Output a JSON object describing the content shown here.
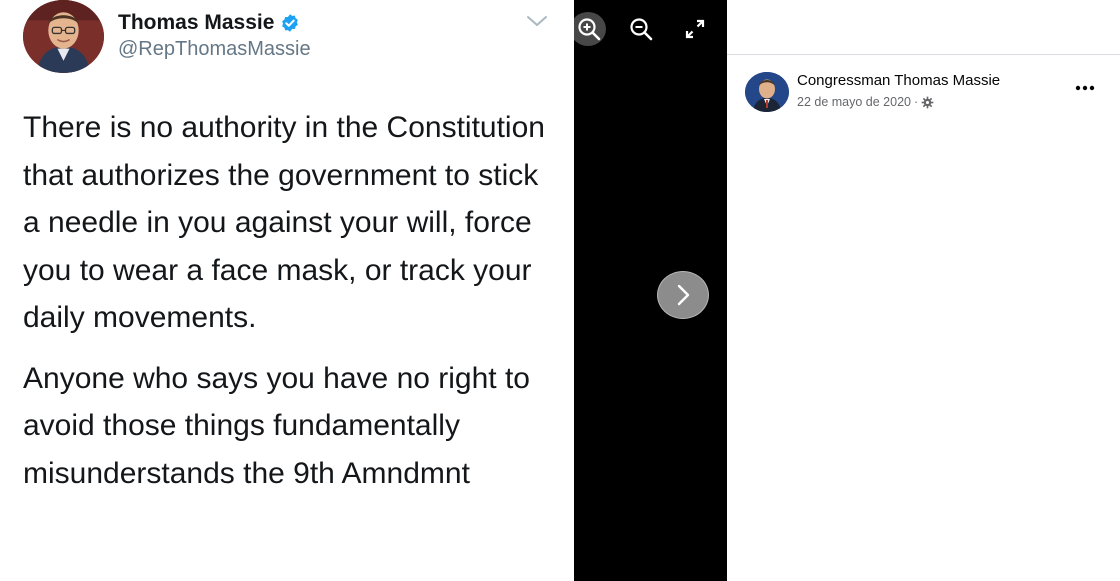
{
  "tweet": {
    "author_name": "Thomas Massie",
    "handle": "@RepThomasMassie",
    "verified": true,
    "paragraphs": [
      "There is no authority in the Constitution that authorizes the government to stick a needle in you against your will, force you to wear a face mask, or track your daily movements.",
      "Anyone who says you have no right to avoid those things fundamentally misunderstands the 9th Amndmnt"
    ]
  },
  "viewer": {
    "tools": [
      "zoom-in",
      "zoom-out",
      "expand"
    ],
    "next_button": "chevron-right"
  },
  "post": {
    "author": "Congressman Thomas Massie",
    "date": "22 de mayo de 2020",
    "separator": "·",
    "audience_icon": "gear-icon",
    "options_icon": "more-dots-icon"
  },
  "colors": {
    "verified_blue": "#1da1f2",
    "viewer_bg": "#000000",
    "meta_gray": "#65676b"
  }
}
